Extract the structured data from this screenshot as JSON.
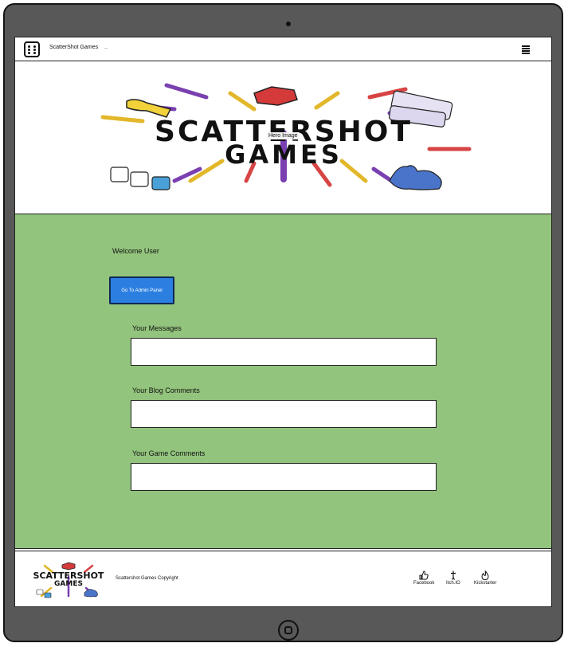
{
  "navbar": {
    "brand_name": "ScatterShot Games",
    "brand_extra": "..",
    "brand_icon": "dice-icon",
    "menu_icon": "hamburger-menu-icon"
  },
  "hero": {
    "logo_line1": "SCATTERSHOT",
    "logo_line2": "GAMES",
    "placeholder_label": "Hero Image"
  },
  "main": {
    "welcome_text": "Welcome User",
    "admin_button_label": "Go To Admin Panel",
    "sections": [
      {
        "label": "Your Messages"
      },
      {
        "label": "Your Blog Comments"
      },
      {
        "label": "Your Game Comments"
      }
    ],
    "background_color": "#93c47d",
    "button_color": "#2b7fe0"
  },
  "footer": {
    "logo_line1": "SCATTERSHOT",
    "logo_line2": "GAMES",
    "copyright": "Scattershot Games Copyright",
    "social_links": [
      {
        "label": "Facebook",
        "icon": "thumbs-up-icon"
      },
      {
        "label": "Itch.IO",
        "icon": "sword-icon"
      },
      {
        "label": "Kickstarter",
        "icon": "flame-icon"
      }
    ]
  }
}
